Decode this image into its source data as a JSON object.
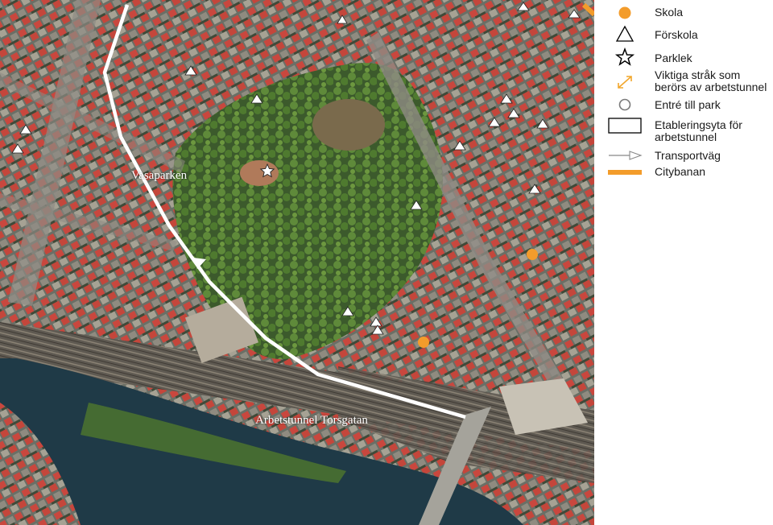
{
  "map": {
    "labels": {
      "park": "Vasaparken",
      "tunnel": "Arbetstunnel Torsgatan"
    },
    "markers": {
      "schools": 2,
      "preschools": 15,
      "playgrounds": 1
    }
  },
  "legend": {
    "items": [
      {
        "label": "Skola",
        "icon": "orange-circle-icon",
        "color": "#f39c2b"
      },
      {
        "label": "Förskola",
        "icon": "triangle-outline-icon",
        "color": "#000000"
      },
      {
        "label": "Parklek",
        "icon": "star-outline-icon",
        "color": "#000000"
      },
      {
        "label": "Viktiga stråk som berörs av arbetstunnel",
        "icon": "double-arrow-icon",
        "color": "#f2a72c"
      },
      {
        "label": "Entré till park",
        "icon": "circle-outline-icon",
        "color": "#7a7a7a"
      },
      {
        "label": "Etableringsyta för arbetstunnel",
        "icon": "rectangle-outline-icon",
        "color": "#000000"
      },
      {
        "label": "Transportväg",
        "icon": "arrow-line-icon",
        "color": "#888888"
      },
      {
        "label": "Citybanan",
        "icon": "line-icon",
        "color": "#f39c2b"
      }
    ]
  }
}
